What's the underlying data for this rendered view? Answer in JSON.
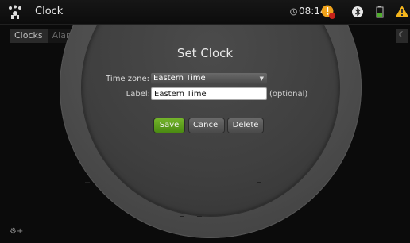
{
  "status_bar": {
    "app_title": "Clock",
    "time": "08:14",
    "icons": [
      "app-pinwheel-icon",
      "alarm-icon",
      "notification-alert-icon",
      "bluetooth-icon",
      "battery-charging-icon",
      "warning-icon"
    ]
  },
  "tabs": [
    {
      "label": "Clocks",
      "active": true
    },
    {
      "label": "Alarms",
      "active": false
    }
  ],
  "dialog": {
    "title": "Set Clock",
    "timezone_label": "Time zone:",
    "timezone_value": "Eastern Time",
    "label_label": "Label:",
    "label_value": "Eastern Time",
    "optional_text": "(optional)",
    "save_label": "Save",
    "cancel_label": "Cancel",
    "delete_label": "Delete"
  },
  "colors": {
    "save_button": "#5c9d1c",
    "dialog_disc": "#4d4d4d"
  }
}
